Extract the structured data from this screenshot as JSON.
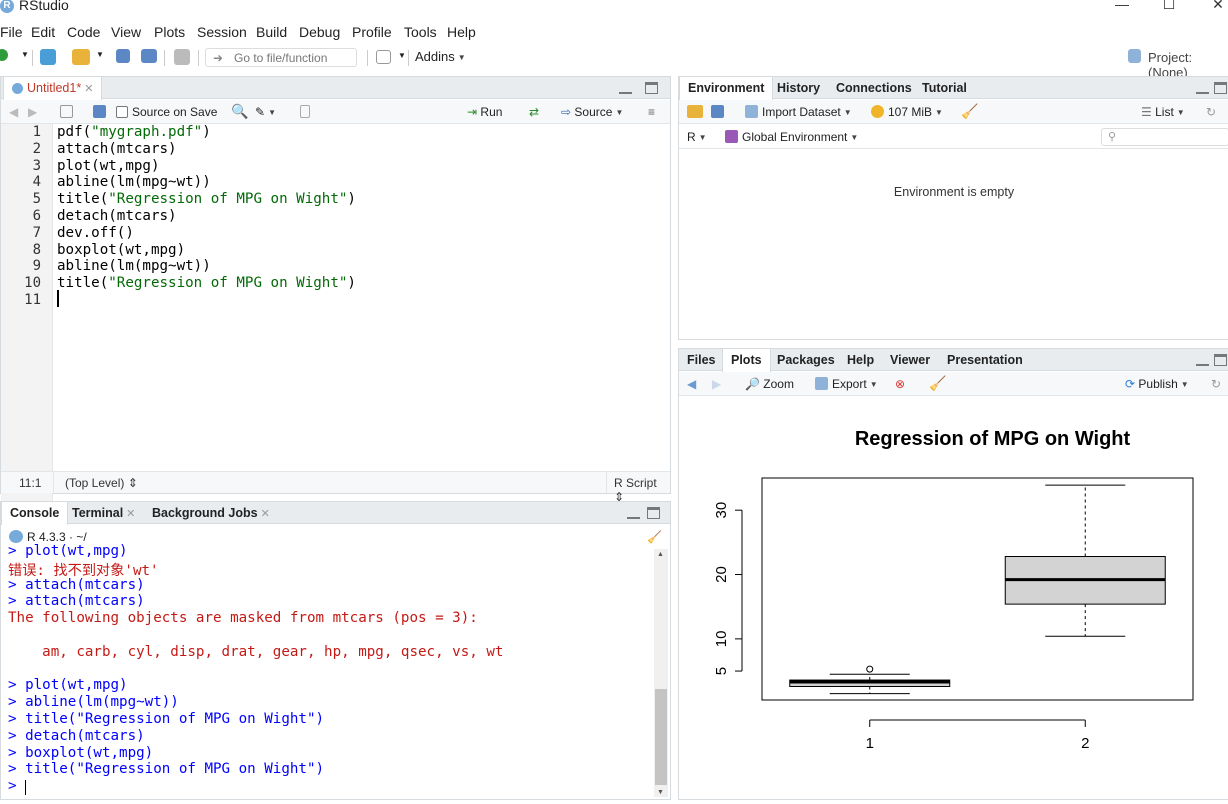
{
  "window": {
    "title": "RStudio",
    "logo": "R"
  },
  "menu": [
    "File",
    "Edit",
    "Code",
    "View",
    "Plots",
    "Session",
    "Build",
    "Debug",
    "Profile",
    "Tools",
    "Help"
  ],
  "toolbar": {
    "goto_placeholder": "Go to file/function",
    "addins_label": "Addins",
    "project_label": "Project: (None)"
  },
  "editor": {
    "tab_label": "Untitled1*",
    "source_on_save": "Source on Save",
    "run_label": "Run",
    "source_label": "Source",
    "lines": [
      {
        "n": "1",
        "pre": "pdf(",
        "str": "\"mygraph.pdf\"",
        "post": ")"
      },
      {
        "n": "2",
        "pre": "attach(mtcars)",
        "str": "",
        "post": ""
      },
      {
        "n": "3",
        "pre": "plot(wt,mpg)",
        "str": "",
        "post": ""
      },
      {
        "n": "4",
        "pre": "abline(lm(mpg~wt))",
        "str": "",
        "post": ""
      },
      {
        "n": "5",
        "pre": "title(",
        "str": "\"Regression of MPG on Wight\"",
        "post": ")"
      },
      {
        "n": "6",
        "pre": "detach(mtcars)",
        "str": "",
        "post": ""
      },
      {
        "n": "7",
        "pre": "dev.off()",
        "str": "",
        "post": ""
      },
      {
        "n": "8",
        "pre": "boxplot(wt,mpg)",
        "str": "",
        "post": ""
      },
      {
        "n": "9",
        "pre": "abline(lm(mpg~wt))",
        "str": "",
        "post": ""
      },
      {
        "n": "10",
        "pre": "title(",
        "str": "\"Regression of MPG on Wight\"",
        "post": ")"
      },
      {
        "n": "11",
        "pre": "",
        "str": "",
        "post": ""
      }
    ],
    "status_pos": "11:1",
    "status_level": "(Top Level)",
    "status_type": "R Script"
  },
  "console": {
    "tabs": [
      "Console",
      "Terminal",
      "Background Jobs"
    ],
    "r_version": "R 4.3.3 · ~/",
    "lines": [
      {
        "kind": "cmd",
        "text": "> plot(wt,mpg)"
      },
      {
        "kind": "err",
        "text": "错误: 找不到对象'wt'"
      },
      {
        "kind": "cmd",
        "text": "> attach(mtcars)"
      },
      {
        "kind": "cmd",
        "text": "> attach(mtcars)"
      },
      {
        "kind": "out",
        "text": "The following objects are masked from mtcars (pos = 3):"
      },
      {
        "kind": "out",
        "text": ""
      },
      {
        "kind": "out",
        "text": "    am, carb, cyl, disp, drat, gear, hp, mpg, qsec, vs, wt"
      },
      {
        "kind": "out",
        "text": ""
      },
      {
        "kind": "cmd",
        "text": "> plot(wt,mpg)"
      },
      {
        "kind": "cmd",
        "text": "> abline(lm(mpg~wt))"
      },
      {
        "kind": "cmd",
        "text": "> title(\"Regression of MPG on Wight\")"
      },
      {
        "kind": "cmd",
        "text": "> detach(mtcars)"
      },
      {
        "kind": "cmd",
        "text": "> boxplot(wt,mpg)"
      },
      {
        "kind": "cmd",
        "text": "> title(\"Regression of MPG on Wight\")"
      },
      {
        "kind": "cmd",
        "text": "> "
      }
    ]
  },
  "environment": {
    "tabs": [
      "Environment",
      "History",
      "Connections",
      "Tutorial"
    ],
    "import_label": "Import Dataset",
    "memory_label": "107 MiB",
    "list_label": "List",
    "lang_label": "R",
    "scope_label": "Global Environment",
    "empty_message": "Environment is empty"
  },
  "files": {
    "tabs": [
      "Files",
      "Plots",
      "Packages",
      "Help",
      "Viewer",
      "Presentation"
    ],
    "zoom_label": "Zoom",
    "export_label": "Export",
    "publish_label": "Publish"
  },
  "chart_data": {
    "type": "boxplot",
    "title": "Regression of MPG on Wight",
    "categories": [
      "1",
      "2"
    ],
    "series": [
      {
        "min": 1.5,
        "q1": 2.6,
        "median": 3.3,
        "q3": 3.6,
        "max": 4.5,
        "outliers": [
          5.3
        ]
      },
      {
        "min": 10.4,
        "q1": 15.4,
        "median": 19.2,
        "q3": 22.8,
        "max": 33.9,
        "outliers": []
      }
    ],
    "y_ticks": [
      5,
      10,
      20,
      30
    ],
    "ylim": [
      0.5,
      35
    ],
    "colors": {
      "box_fill": "#d3d3d3",
      "stroke": "#000000"
    }
  }
}
